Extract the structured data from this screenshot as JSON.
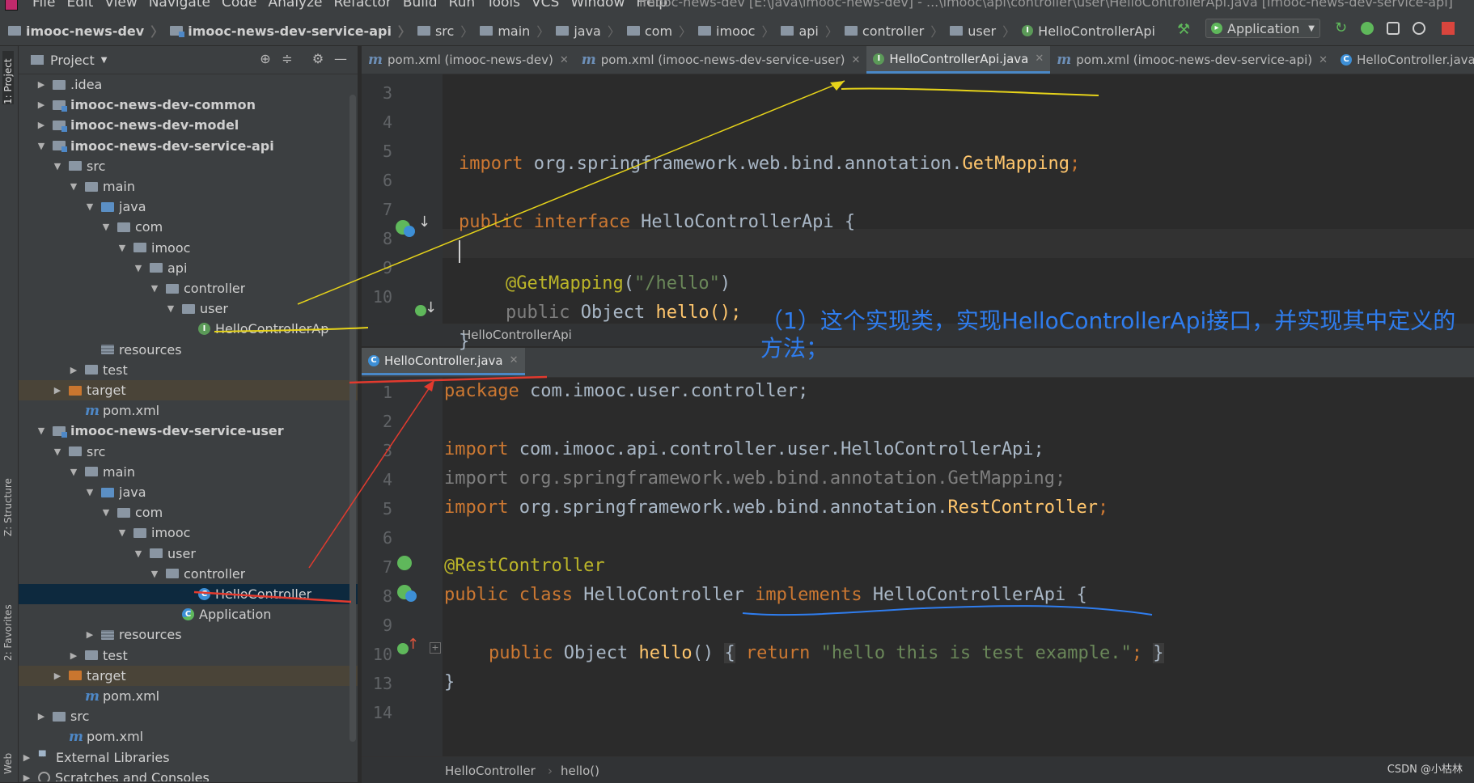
{
  "menubar": {
    "items": [
      "File",
      "Edit",
      "View",
      "Navigate",
      "Code",
      "Analyze",
      "Refactor",
      "Build",
      "Run",
      "Tools",
      "VCS",
      "Window",
      "Help"
    ],
    "window_title": "imooc-news-dev [E:\\java\\imooc-news-dev] - ...\\imooc\\api\\controller\\user\\HelloControllerApi.java [imooc-news-dev-service-api]"
  },
  "navbar": {
    "crumbs": [
      "imooc-news-dev",
      "imooc-news-dev-service-api",
      "src",
      "main",
      "java",
      "com",
      "imooc",
      "api",
      "controller",
      "user",
      "HelloControllerApi"
    ],
    "run_config": "Application"
  },
  "toolstrip": {
    "project": "1: Project",
    "structure": "Z: Structure",
    "favorites": "2: Favorites",
    "web": "Web"
  },
  "project_panel": {
    "title": "Project",
    "tree": [
      {
        "label": ".idea",
        "indent": 0,
        "arrow": "▶",
        "icon": "folder",
        "bold": false
      },
      {
        "label": "imooc-news-dev-common",
        "indent": 0,
        "arrow": "▶",
        "icon": "module",
        "bold": true
      },
      {
        "label": "imooc-news-dev-model",
        "indent": 0,
        "arrow": "▶",
        "icon": "module",
        "bold": true
      },
      {
        "label": "imooc-news-dev-service-api",
        "indent": 0,
        "arrow": "▼",
        "icon": "module",
        "bold": true
      },
      {
        "label": "src",
        "indent": 1,
        "arrow": "▼",
        "icon": "folder",
        "bold": false
      },
      {
        "label": "main",
        "indent": 2,
        "arrow": "▼",
        "icon": "folder",
        "bold": false
      },
      {
        "label": "java",
        "indent": 3,
        "arrow": "▼",
        "icon": "src",
        "bold": false
      },
      {
        "label": "com",
        "indent": 4,
        "arrow": "▼",
        "icon": "package",
        "bold": false
      },
      {
        "label": "imooc",
        "indent": 5,
        "arrow": "▼",
        "icon": "package",
        "bold": false
      },
      {
        "label": "api",
        "indent": 6,
        "arrow": "▼",
        "icon": "package",
        "bold": false
      },
      {
        "label": "controller",
        "indent": 7,
        "arrow": "▼",
        "icon": "package",
        "bold": false
      },
      {
        "label": "user",
        "indent": 8,
        "arrow": "▼",
        "icon": "package",
        "bold": false
      },
      {
        "label": "HelloControllerAp",
        "indent": 9,
        "arrow": "",
        "icon": "interface",
        "bold": false
      },
      {
        "label": "resources",
        "indent": 3,
        "arrow": "",
        "icon": "resources",
        "bold": false
      },
      {
        "label": "test",
        "indent": 2,
        "arrow": "▶",
        "icon": "folder",
        "bold": false
      },
      {
        "label": "target",
        "indent": 1,
        "arrow": "▶",
        "icon": "target",
        "bold": false
      },
      {
        "label": "pom.xml",
        "indent": 2,
        "arrow": "",
        "icon": "maven",
        "bold": false
      },
      {
        "label": "imooc-news-dev-service-user",
        "indent": 0,
        "arrow": "▼",
        "icon": "module",
        "bold": true
      },
      {
        "label": "src",
        "indent": 1,
        "arrow": "▼",
        "icon": "folder",
        "bold": false
      },
      {
        "label": "main",
        "indent": 2,
        "arrow": "▼",
        "icon": "folder",
        "bold": false
      },
      {
        "label": "java",
        "indent": 3,
        "arrow": "▼",
        "icon": "src",
        "bold": false
      },
      {
        "label": "com",
        "indent": 4,
        "arrow": "▼",
        "icon": "package",
        "bold": false
      },
      {
        "label": "imooc",
        "indent": 5,
        "arrow": "▼",
        "icon": "package",
        "bold": false
      },
      {
        "label": "user",
        "indent": 6,
        "arrow": "▼",
        "icon": "package",
        "bold": false
      },
      {
        "label": "controller",
        "indent": 7,
        "arrow": "▼",
        "icon": "package",
        "bold": false
      },
      {
        "label": "HelloController",
        "indent": 9,
        "arrow": "",
        "icon": "class",
        "bold": false
      },
      {
        "label": "Application",
        "indent": 8,
        "arrow": "",
        "icon": "spring-class",
        "bold": false
      },
      {
        "label": "resources",
        "indent": 3,
        "arrow": "▶",
        "icon": "resources",
        "bold": false
      },
      {
        "label": "test",
        "indent": 2,
        "arrow": "▶",
        "icon": "folder",
        "bold": false
      },
      {
        "label": "target",
        "indent": 1,
        "arrow": "▶",
        "icon": "target",
        "bold": false
      },
      {
        "label": "pom.xml",
        "indent": 2,
        "arrow": "",
        "icon": "maven",
        "bold": false
      },
      {
        "label": "src",
        "indent": 0,
        "arrow": "▶",
        "icon": "folder",
        "bold": false
      },
      {
        "label": "pom.xml",
        "indent": 1,
        "arrow": "",
        "icon": "maven",
        "bold": false
      },
      {
        "label": "External Libraries",
        "indent": -1,
        "arrow": "▶",
        "icon": "libraries",
        "bold": false
      },
      {
        "label": "Scratches and Consoles",
        "indent": -1,
        "arrow": "▶",
        "icon": "scratches",
        "bold": false
      }
    ]
  },
  "editor_top": {
    "tabs": [
      {
        "label": "pom.xml (imooc-news-dev)",
        "icon": "maven",
        "active": false
      },
      {
        "label": "pom.xml (imooc-news-dev-service-user)",
        "icon": "maven",
        "active": false
      },
      {
        "label": "HelloControllerApi.java",
        "icon": "interface",
        "active": true
      },
      {
        "label": "pom.xml (imooc-news-dev-service-api)",
        "icon": "maven",
        "active": false
      },
      {
        "label": "HelloController.java",
        "icon": "class",
        "active": false
      }
    ],
    "line_numbers": [
      "3",
      "4",
      "5",
      "6",
      "7",
      "8",
      "9",
      "10"
    ],
    "code": {
      "l4_kw": "import",
      "l4_pkg": " org.springframework.web.bind.annotation.",
      "l4_cls": "GetMapping",
      "l4_end": ";",
      "l6_kw1": "public",
      "l6_kw2": " interface",
      "l6_name": " HelloControllerApi {",
      "l8_ann": "@GetMapping",
      "l8_open": "(",
      "l8_str": "\"/hello\"",
      "l8_close": ")",
      "l9_kw": "public",
      "l9_type": " Object ",
      "l9_fn": "hello",
      "l9_end": "();",
      "l10": "}"
    },
    "breadcrumb": "HelloControllerApi"
  },
  "annotation_note": "（1）这个实现类，实现HelloControllerApi接口，并实现其中定义的方法；",
  "editor_bottom": {
    "tabs": [
      {
        "label": "HelloController.java",
        "icon": "class",
        "active": true
      }
    ],
    "line_numbers": [
      "1",
      "2",
      "3",
      "4",
      "5",
      "6",
      "7",
      "8",
      "9",
      "10",
      "13",
      "14"
    ],
    "code": {
      "l1_kw": "package",
      "l1_rest": " com.imooc.user.controller;",
      "l3_kw": "import",
      "l3_rest": " com.imooc.api.controller.user.HelloControllerApi;",
      "l4_dim": "import org.springframework.web.bind.annotation.GetMapping;",
      "l5_kw": "import",
      "l5_pkg": " org.springframework.web.bind.annotation.",
      "l5_cls": "RestController",
      "l5_end": ";",
      "l7_ann": "@RestController",
      "l8_kw1": "public class",
      "l8_name": " HelloController ",
      "l8_kw2": "implements",
      "l8_iface": " HelloControllerApi {",
      "l10_kw": "public",
      "l10_type": " Object ",
      "l10_fn": "hello",
      "l10_paren": "() ",
      "l10_brace": "{",
      "l10_ret": " return ",
      "l10_str": "\"hello this is test example.\"",
      "l10_semi": "; ",
      "l10_close": "}",
      "l13": "}"
    },
    "breadcrumb": [
      "HelloController",
      "hello()"
    ]
  },
  "watermark": "CSDN @小枯林"
}
